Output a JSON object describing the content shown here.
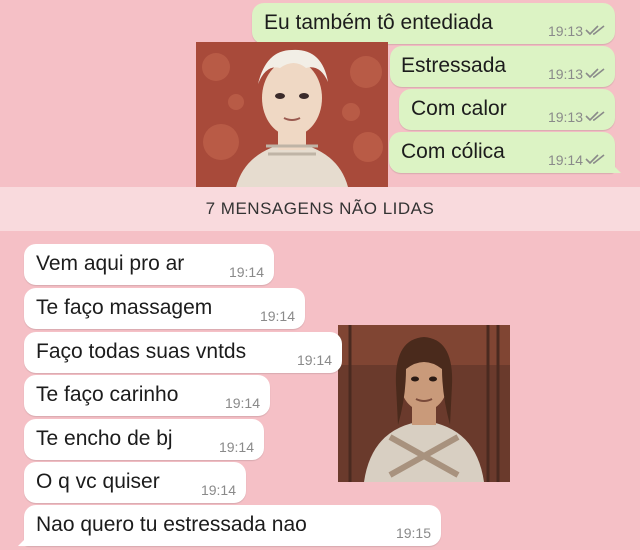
{
  "colors": {
    "background": "#f5c0c6",
    "outgoing_bubble": "#dcf3c4",
    "incoming_bubble": "#ffffff",
    "unread_banner": "#f9dadd",
    "tick_color": "#8a8a8a"
  },
  "outgoing": [
    {
      "text": "Eu também tô entediada",
      "time": "19:13",
      "status_icon": "double-check-icon"
    },
    {
      "text": "Estressada",
      "time": "19:13",
      "status_icon": "double-check-icon"
    },
    {
      "text": "Com calor",
      "time": "19:13",
      "status_icon": "double-check-icon"
    },
    {
      "text": "Com cólica",
      "time": "19:14",
      "status_icon": "double-check-icon"
    }
  ],
  "unread_banner": "7 MENSAGENS NÃO LIDAS",
  "incoming": [
    {
      "text": "Vem aqui pro ar",
      "time": "19:14"
    },
    {
      "text": "Te faço massagem",
      "time": "19:14"
    },
    {
      "text": "Faço todas suas vntds",
      "time": "19:14"
    },
    {
      "text": "Te faço carinho",
      "time": "19:14"
    },
    {
      "text": "Te encho de bj",
      "time": "19:14"
    },
    {
      "text": "O q vc quiser",
      "time": "19:14"
    },
    {
      "text": "Nao quero tu estressada nao",
      "time": "19:15"
    }
  ],
  "stickers": [
    {
      "name": "pale-haired-character-sticker"
    },
    {
      "name": "long-haired-warrior-sticker"
    }
  ]
}
